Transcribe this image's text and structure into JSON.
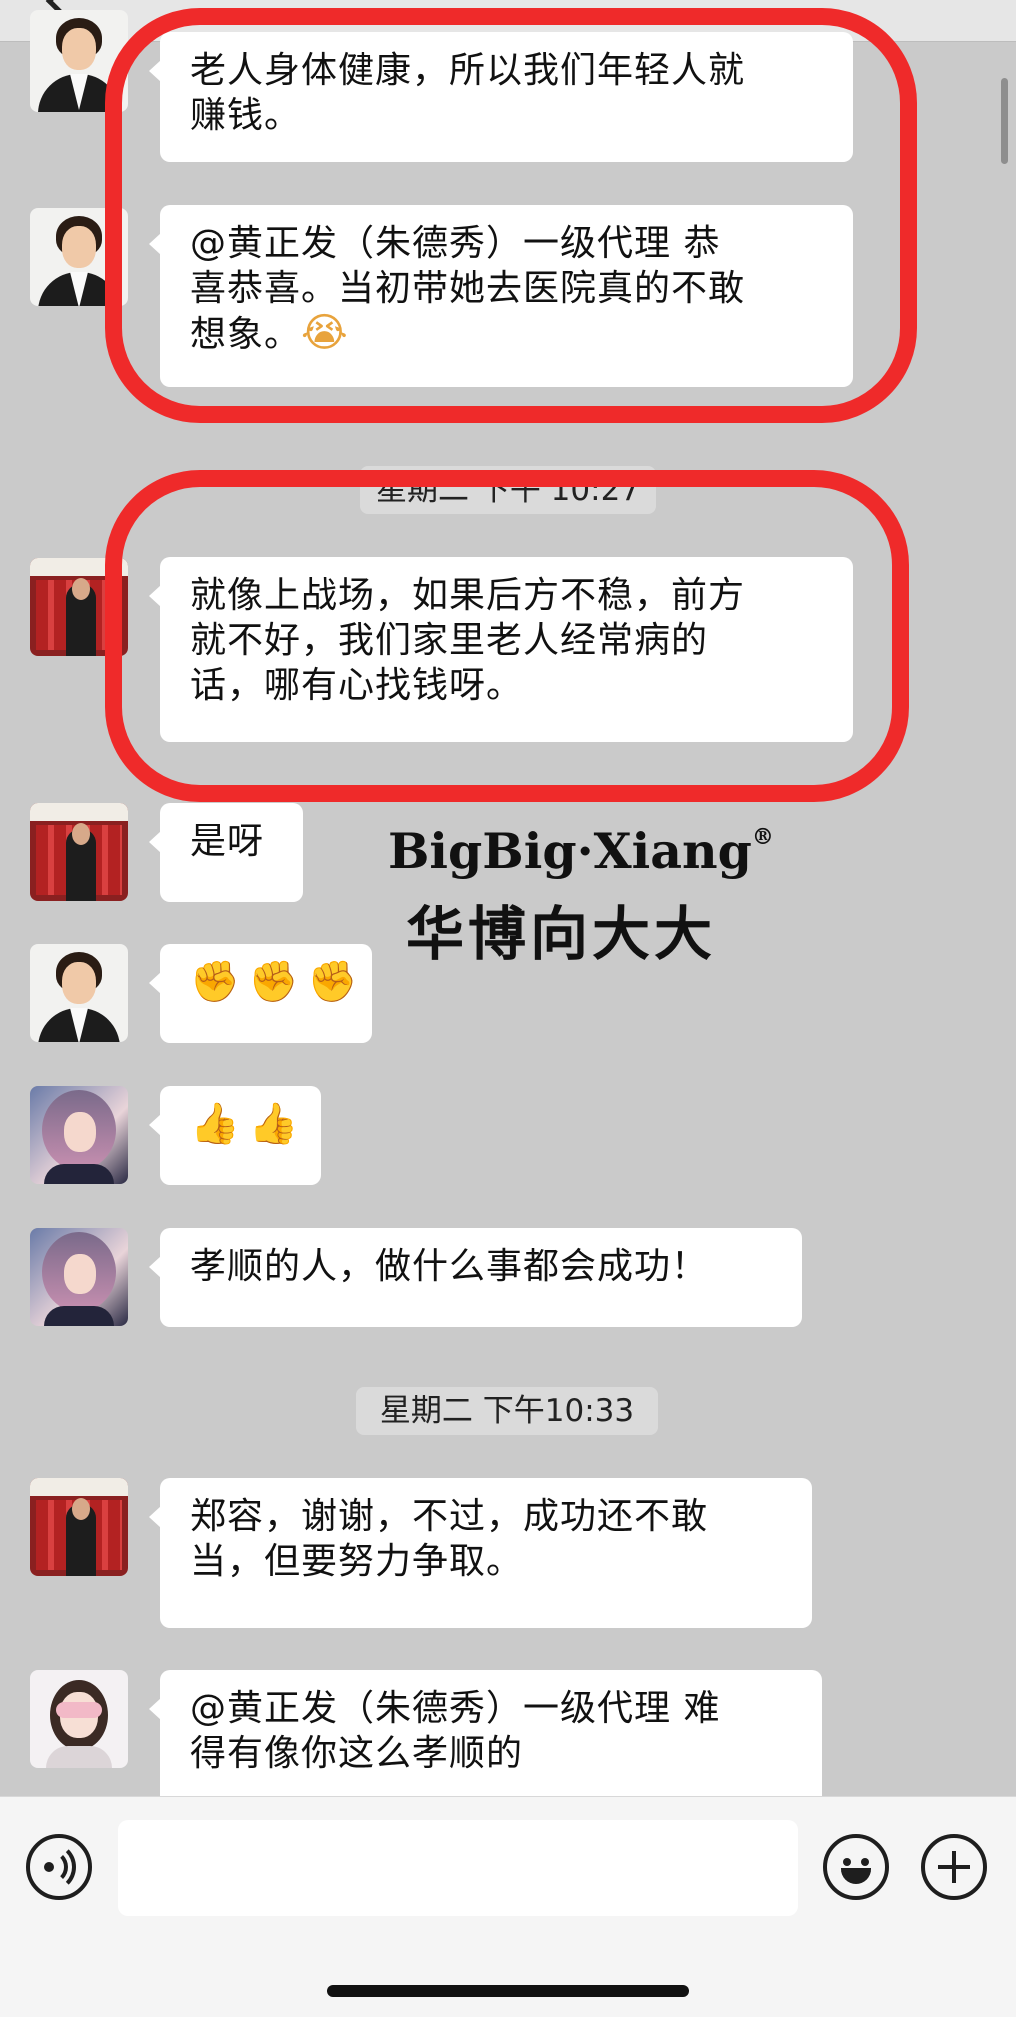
{
  "messages": [
    {
      "avatar": "avatar-woman-suit",
      "lines": [
        "老人身体健康，所以我们年轻人就",
        "赚钱。"
      ]
    },
    {
      "avatar": "avatar-woman-suit",
      "lines": [
        "@黄正发（朱德秀）一级代理 恭",
        "喜恭喜。当初带她去医院真的不敢",
        "想象。"
      ],
      "trailing_emoji": "😭"
    },
    {
      "avatar": "avatar-man-red-room",
      "lines": [
        "就像上战场，如果后方不稳，前方",
        "就不好，我们家里老人经常病的",
        "话，哪有心找钱呀。"
      ]
    },
    {
      "avatar": "avatar-man-red-room",
      "lines": [
        "是呀"
      ]
    },
    {
      "avatar": "avatar-woman-suit",
      "emojis": [
        "✊",
        "✊",
        "✊"
      ]
    },
    {
      "avatar": "avatar-lady-purple-hair",
      "emojis": [
        "👍",
        "👍"
      ]
    },
    {
      "avatar": "avatar-lady-purple-hair",
      "lines": [
        "孝顺的人，做什么事都会成功！"
      ]
    },
    {
      "avatar": "avatar-man-red-room",
      "lines": [
        "郑容，谢谢，不过，成功还不敢",
        "当，但要努力争取。"
      ]
    },
    {
      "avatar": "avatar-lady-mask",
      "lines": [
        "@黄正发（朱德秀）一级代理 难",
        "得有像你这么孝顺的"
      ]
    }
  ],
  "timestamps": {
    "partial": "星期二 下午 10:27",
    "full": "星期二 下午10:33"
  },
  "watermark": {
    "english": "BigBig·Xiang",
    "registered": "®",
    "chinese": "华博向大大"
  },
  "input_bar": {
    "voice_icon": "voice-icon",
    "text_value": "",
    "emoji_icon": "emoji-icon",
    "plus_icon": "plus-icon"
  },
  "colors": {
    "chat_background": "#cacaca",
    "bubble": "#ffffff",
    "highlight_ring": "#ef2a2a"
  }
}
